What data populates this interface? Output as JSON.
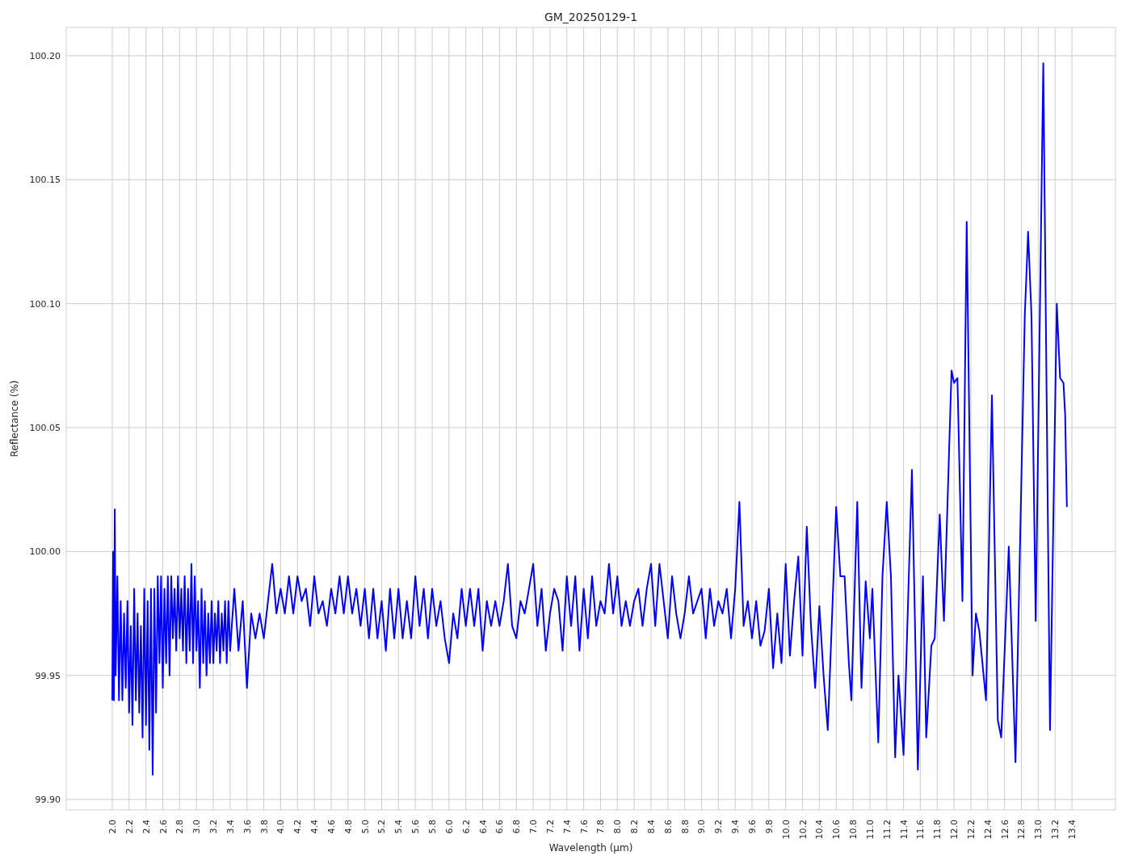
{
  "figure": {
    "chart_data": {
      "type": "line",
      "title": "GM_20250129-1",
      "xlabel": "Wavelength (µm)",
      "ylabel": "Reflectance (%)",
      "grid": true,
      "xlim": [
        1.453,
        13.918
      ],
      "ylim": [
        99.8958,
        100.2114
      ],
      "xticks": [
        {
          "value": 2.0,
          "label": "2.0"
        },
        {
          "value": 2.2,
          "label": "2.2"
        },
        {
          "value": 2.4,
          "label": "2.4"
        },
        {
          "value": 2.6,
          "label": "2.6"
        },
        {
          "value": 2.8,
          "label": "2.8"
        },
        {
          "value": 3.0,
          "label": "3.0"
        },
        {
          "value": 3.2,
          "label": "3.2"
        },
        {
          "value": 3.4,
          "label": "3.4"
        },
        {
          "value": 3.6,
          "label": "3.6"
        },
        {
          "value": 3.8,
          "label": "3.8"
        },
        {
          "value": 4.0,
          "label": "4.0"
        },
        {
          "value": 4.2,
          "label": "4.2"
        },
        {
          "value": 4.4,
          "label": "4.4"
        },
        {
          "value": 4.6,
          "label": "4.6"
        },
        {
          "value": 4.8,
          "label": "4.8"
        },
        {
          "value": 5.0,
          "label": "5.0"
        },
        {
          "value": 5.2,
          "label": "5.2"
        },
        {
          "value": 5.4,
          "label": "5.4"
        },
        {
          "value": 5.6,
          "label": "5.6"
        },
        {
          "value": 5.8,
          "label": "5.8"
        },
        {
          "value": 6.0,
          "label": "6.0"
        },
        {
          "value": 6.2,
          "label": "6.2"
        },
        {
          "value": 6.4,
          "label": "6.4"
        },
        {
          "value": 6.6,
          "label": "6.6"
        },
        {
          "value": 6.8,
          "label": "6.8"
        },
        {
          "value": 7.0,
          "label": "7.0"
        },
        {
          "value": 7.2,
          "label": "7.2"
        },
        {
          "value": 7.4,
          "label": "7.4"
        },
        {
          "value": 7.6,
          "label": "7.6"
        },
        {
          "value": 7.8,
          "label": "7.8"
        },
        {
          "value": 8.0,
          "label": "8.0"
        },
        {
          "value": 8.2,
          "label": "8.2"
        },
        {
          "value": 8.4,
          "label": "8.4"
        },
        {
          "value": 8.6,
          "label": "8.6"
        },
        {
          "value": 8.8,
          "label": "8.8"
        },
        {
          "value": 9.0,
          "label": "9.0"
        },
        {
          "value": 9.2,
          "label": "9.2"
        },
        {
          "value": 9.4,
          "label": "9.4"
        },
        {
          "value": 9.6,
          "label": "9.6"
        },
        {
          "value": 9.8,
          "label": "9.8"
        },
        {
          "value": 10.0,
          "label": "10.0"
        },
        {
          "value": 10.2,
          "label": "10.2"
        },
        {
          "value": 10.4,
          "label": "10.4"
        },
        {
          "value": 10.6,
          "label": "10.6"
        },
        {
          "value": 10.8,
          "label": "10.8"
        },
        {
          "value": 11.0,
          "label": "11.0"
        },
        {
          "value": 11.2,
          "label": "11.2"
        },
        {
          "value": 11.4,
          "label": "11.4"
        },
        {
          "value": 11.6,
          "label": "11.6"
        },
        {
          "value": 11.8,
          "label": "11.8"
        },
        {
          "value": 12.0,
          "label": "12.0"
        },
        {
          "value": 12.2,
          "label": "12.2"
        },
        {
          "value": 12.4,
          "label": "12.4"
        },
        {
          "value": 12.6,
          "label": "12.6"
        },
        {
          "value": 12.8,
          "label": "12.8"
        },
        {
          "value": 13.0,
          "label": "13.0"
        },
        {
          "value": 13.2,
          "label": "13.2"
        },
        {
          "value": 13.4,
          "label": "13.4"
        }
      ],
      "yticks": [
        {
          "value": 99.9,
          "label": "99.90"
        },
        {
          "value": 99.95,
          "label": "99.95"
        },
        {
          "value": 100.0,
          "label": "100.00"
        },
        {
          "value": 100.05,
          "label": "100.05"
        },
        {
          "value": 100.1,
          "label": "100.10"
        },
        {
          "value": 100.15,
          "label": "100.15"
        },
        {
          "value": 100.2,
          "label": "100.20"
        }
      ],
      "x": [
        2.0,
        2.01,
        2.02,
        2.03,
        2.04,
        2.06,
        2.08,
        2.1,
        2.12,
        2.14,
        2.16,
        2.18,
        2.2,
        2.22,
        2.24,
        2.26,
        2.28,
        2.3,
        2.32,
        2.34,
        2.36,
        2.38,
        2.4,
        2.42,
        2.44,
        2.46,
        2.48,
        2.5,
        2.52,
        2.54,
        2.56,
        2.58,
        2.6,
        2.62,
        2.64,
        2.66,
        2.68,
        2.7,
        2.72,
        2.74,
        2.76,
        2.78,
        2.8,
        2.82,
        2.84,
        2.86,
        2.88,
        2.9,
        2.92,
        2.94,
        2.96,
        2.98,
        3.0,
        3.02,
        3.04,
        3.06,
        3.08,
        3.1,
        3.12,
        3.14,
        3.16,
        3.18,
        3.2,
        3.22,
        3.24,
        3.26,
        3.28,
        3.3,
        3.32,
        3.34,
        3.36,
        3.38,
        3.4,
        3.45,
        3.5,
        3.55,
        3.6,
        3.65,
        3.7,
        3.75,
        3.8,
        3.85,
        3.9,
        3.95,
        4.0,
        4.05,
        4.1,
        4.15,
        4.2,
        4.25,
        4.3,
        4.35,
        4.4,
        4.45,
        4.5,
        4.55,
        4.6,
        4.65,
        4.7,
        4.75,
        4.8,
        4.85,
        4.9,
        4.95,
        5.0,
        5.05,
        5.1,
        5.15,
        5.2,
        5.25,
        5.3,
        5.35,
        5.4,
        5.45,
        5.5,
        5.55,
        5.6,
        5.65,
        5.7,
        5.75,
        5.8,
        5.85,
        5.9,
        5.95,
        6.0,
        6.05,
        6.1,
        6.15,
        6.2,
        6.25,
        6.3,
        6.35,
        6.4,
        6.45,
        6.5,
        6.55,
        6.6,
        6.65,
        6.7,
        6.75,
        6.8,
        6.85,
        6.9,
        6.95,
        7.0,
        7.05,
        7.1,
        7.15,
        7.2,
        7.25,
        7.3,
        7.35,
        7.4,
        7.45,
        7.5,
        7.55,
        7.6,
        7.65,
        7.7,
        7.75,
        7.8,
        7.85,
        7.9,
        7.95,
        8.0,
        8.05,
        8.1,
        8.15,
        8.2,
        8.25,
        8.3,
        8.35,
        8.4,
        8.45,
        8.5,
        8.55,
        8.6,
        8.65,
        8.7,
        8.75,
        8.8,
        8.85,
        8.9,
        8.95,
        9.0,
        9.05,
        9.1,
        9.15,
        9.2,
        9.25,
        9.3,
        9.35,
        9.4,
        9.45,
        9.5,
        9.55,
        9.6,
        9.65,
        9.7,
        9.75,
        9.8,
        9.85,
        9.9,
        9.95,
        10.0,
        10.05,
        10.1,
        10.15,
        10.2,
        10.25,
        10.3,
        10.35,
        10.4,
        10.45,
        10.5,
        10.6,
        10.65,
        10.7,
        10.75,
        10.78,
        10.85,
        10.9,
        10.95,
        11.0,
        11.03,
        11.1,
        11.15,
        11.2,
        11.25,
        11.3,
        11.34,
        11.4,
        11.5,
        11.57,
        11.63,
        11.67,
        11.73,
        11.77,
        11.83,
        11.88,
        11.97,
        12.0,
        12.04,
        12.1,
        12.15,
        12.22,
        12.26,
        12.3,
        12.38,
        12.45,
        12.52,
        12.56,
        12.65,
        12.73,
        12.84,
        12.88,
        12.92,
        12.97,
        13.06,
        13.14,
        13.22,
        13.26,
        13.3,
        13.32,
        13.34
      ],
      "series": [
        {
          "color": "#0000ff",
          "values": [
            99.94,
            100.0,
            99.94,
            100.017,
            99.95,
            99.99,
            99.94,
            99.98,
            99.94,
            99.975,
            99.945,
            99.98,
            99.935,
            99.97,
            99.93,
            99.985,
            99.94,
            99.975,
            99.935,
            99.97,
            99.925,
            99.985,
            99.93,
            99.98,
            99.92,
            99.985,
            99.91,
            99.985,
            99.935,
            99.99,
            99.955,
            99.99,
            99.945,
            99.985,
            99.955,
            99.99,
            99.95,
            99.99,
            99.965,
            99.985,
            99.96,
            99.99,
            99.965,
            99.985,
            99.96,
            99.99,
            99.955,
            99.985,
            99.96,
            99.995,
            99.955,
            99.99,
            99.96,
            99.98,
            99.945,
            99.985,
            99.955,
            99.98,
            99.95,
            99.975,
            99.955,
            99.98,
            99.955,
            99.975,
            99.96,
            99.98,
            99.955,
            99.975,
            99.96,
            99.98,
            99.955,
            99.98,
            99.96,
            99.985,
            99.96,
            99.98,
            99.945,
            99.975,
            99.965,
            99.975,
            99.965,
            99.98,
            99.995,
            99.975,
            99.985,
            99.975,
            99.99,
            99.975,
            99.99,
            99.98,
            99.985,
            99.97,
            99.99,
            99.975,
            99.98,
            99.97,
            99.985,
            99.975,
            99.99,
            99.975,
            99.99,
            99.975,
            99.985,
            99.97,
            99.985,
            99.965,
            99.985,
            99.965,
            99.98,
            99.96,
            99.985,
            99.965,
            99.985,
            99.965,
            99.98,
            99.965,
            99.99,
            99.97,
            99.985,
            99.965,
            99.985,
            99.97,
            99.98,
            99.965,
            99.955,
            99.975,
            99.965,
            99.985,
            99.97,
            99.985,
            99.97,
            99.985,
            99.96,
            99.98,
            99.97,
            99.98,
            99.97,
            99.98,
            99.995,
            99.97,
            99.965,
            99.98,
            99.975,
            99.985,
            99.995,
            99.97,
            99.985,
            99.96,
            99.975,
            99.985,
            99.98,
            99.96,
            99.99,
            99.97,
            99.99,
            99.96,
            99.985,
            99.965,
            99.99,
            99.97,
            99.98,
            99.975,
            99.995,
            99.975,
            99.99,
            99.97,
            99.98,
            99.97,
            99.98,
            99.985,
            99.97,
            99.985,
            99.995,
            99.97,
            99.995,
            99.98,
            99.965,
            99.99,
            99.975,
            99.965,
            99.975,
            99.99,
            99.975,
            99.98,
            99.985,
            99.965,
            99.985,
            99.97,
            99.98,
            99.975,
            99.985,
            99.965,
            99.985,
            100.02,
            99.97,
            99.98,
            99.965,
            99.98,
            99.962,
            99.968,
            99.985,
            99.953,
            99.975,
            99.955,
            99.995,
            99.958,
            99.98,
            99.998,
            99.958,
            100.01,
            99.97,
            99.945,
            99.978,
            99.95,
            99.928,
            100.018,
            99.99,
            99.99,
            99.955,
            99.94,
            100.02,
            99.945,
            99.988,
            99.965,
            99.985,
            99.923,
            99.99,
            100.02,
            99.99,
            99.917,
            99.95,
            99.918,
            100.033,
            99.912,
            99.99,
            99.925,
            99.962,
            99.965,
            100.015,
            99.972,
            100.073,
            100.068,
            100.07,
            99.98,
            100.133,
            99.95,
            99.975,
            99.968,
            99.94,
            100.063,
            99.932,
            99.925,
            100.002,
            99.915,
            100.095,
            100.129,
            100.095,
            99.972,
            100.197,
            99.928,
            100.1,
            100.07,
            100.068,
            100.055,
            100.018
          ]
        }
      ]
    }
  }
}
